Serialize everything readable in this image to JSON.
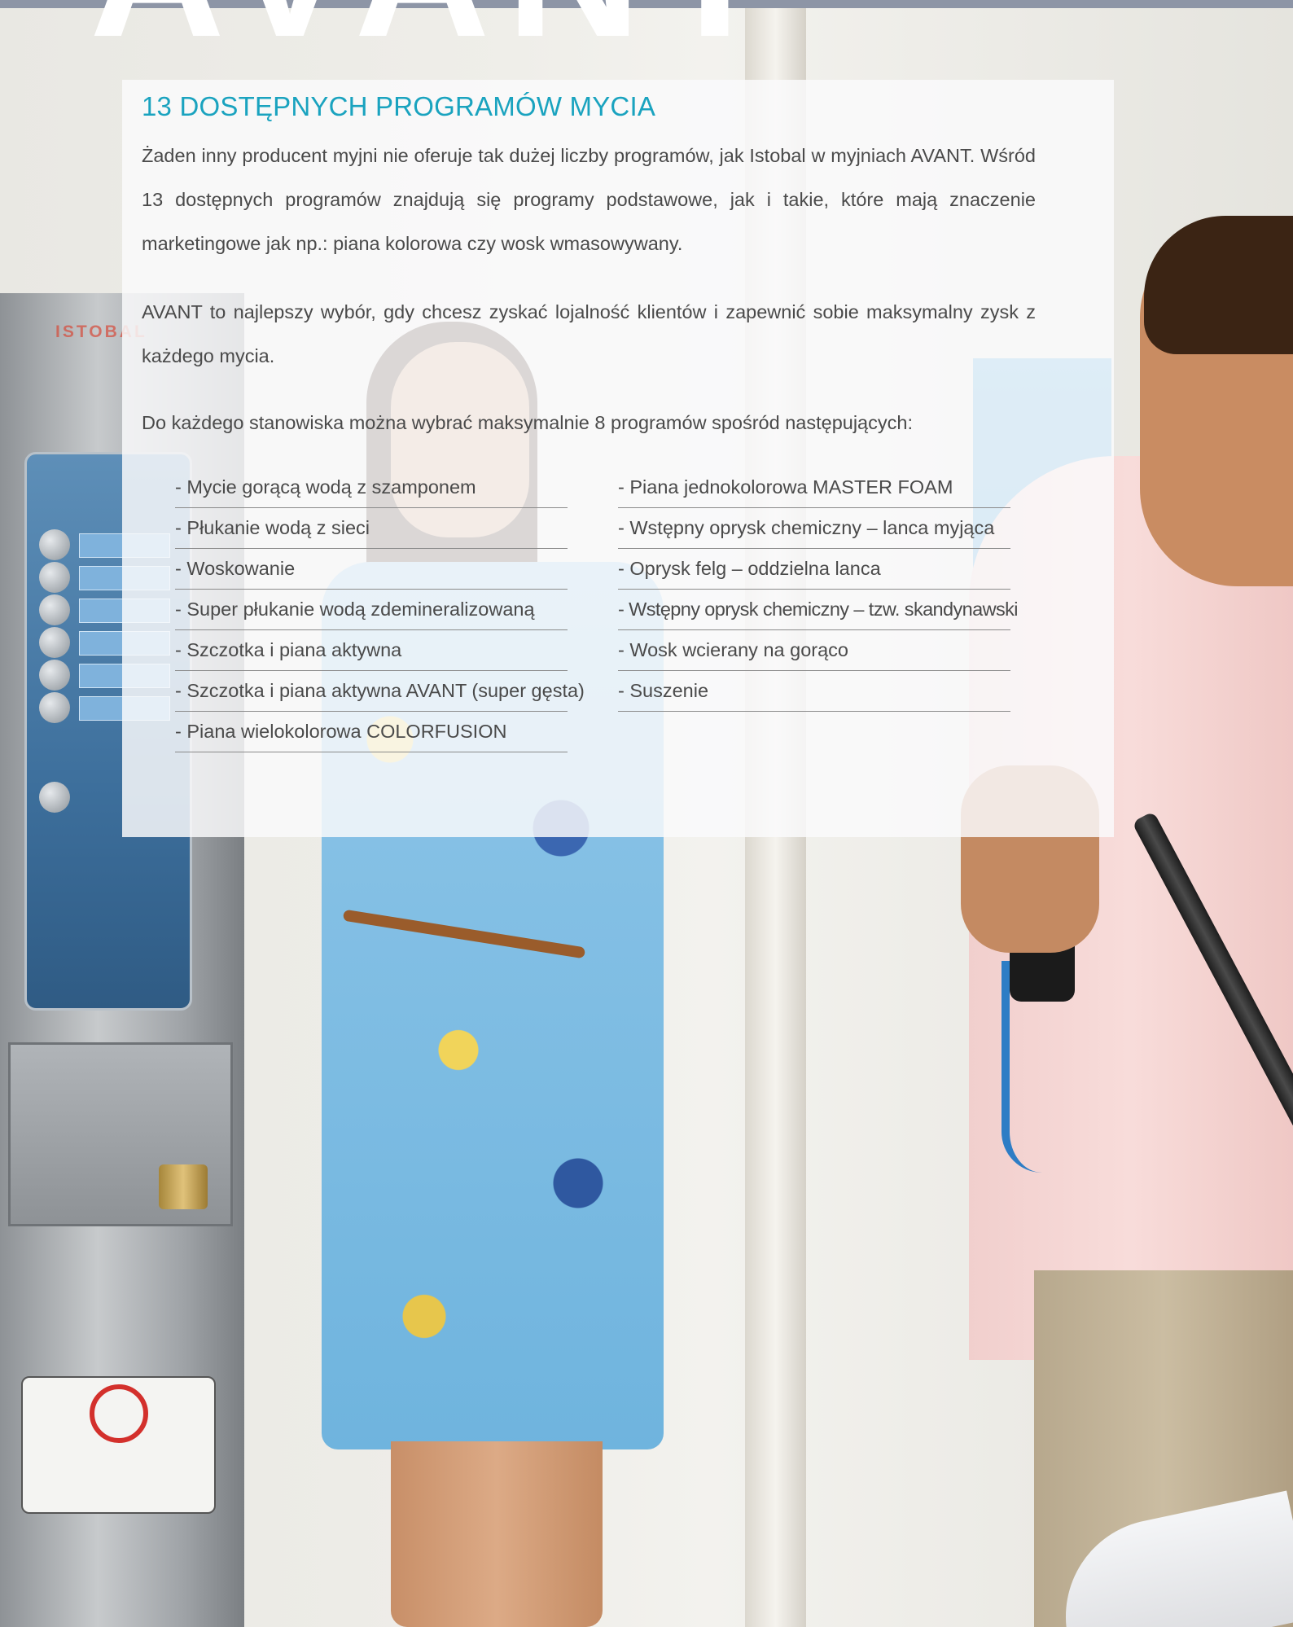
{
  "brand": {
    "big_word": "AVANT",
    "machine_logo": "ISTOBAL"
  },
  "content": {
    "title": "13 DOSTĘPNYCH PROGRAMÓW MYCIA",
    "paragraph_1": "Żaden inny producent myjni nie oferuje tak dużej liczby programów, jak Istobal w myjniach AVANT. Wśród 13 dostępnych programów znajdują się programy podstawowe, jak i takie, które mają znaczenie marketingowe jak np.: piana kolorowa czy wosk wmasowywany.",
    "paragraph_2": "AVANT to najlepszy wybór, gdy chcesz zyskać lojalność klientów i zapewnić sobie maksymalny zysk z każdego mycia.",
    "paragraph_3": "Do każdego stanowiska można wybrać maksymalnie 8 programów spośród następujących:",
    "programs_left": [
      "- Mycie gorącą wodą z szamponem",
      "- Płukanie wodą z sieci",
      "- Woskowanie",
      "- Super płukanie wodą zdemineralizowaną",
      "- Szczotka i piana aktywna",
      "- Szczotka i piana aktywna AVANT (super gęsta)",
      "- Piana wielokolorowa COLORFUSION"
    ],
    "programs_right": [
      "- Piana jednokolorowa MASTER FOAM",
      "- Wstępny oprysk chemiczny – lanca myjąca",
      "- Oprysk felg – oddzielna lanca",
      "- Wstępny oprysk chemiczny – tzw. skandynawski",
      "- Wosk wcierany na gorąco",
      "- Suszenie"
    ]
  },
  "colors": {
    "accent": "#1aa3bf",
    "text": "#4a4a4a",
    "panel": "#fafafc"
  }
}
